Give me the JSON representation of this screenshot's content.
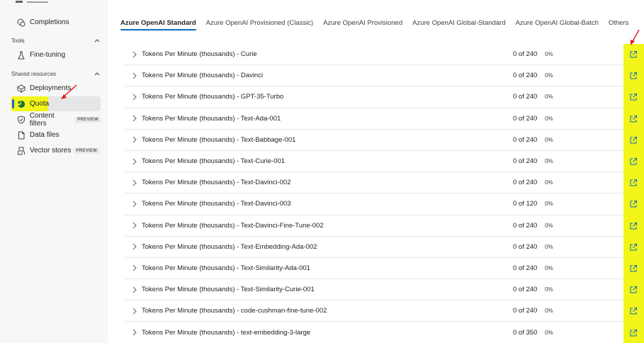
{
  "sidebar": {
    "items": [
      {
        "label": "Completions",
        "icon": "chat-icon"
      },
      {
        "label": "Fine-tuning",
        "icon": "flask-icon"
      },
      {
        "label": "Deployments",
        "icon": "cube-icon"
      },
      {
        "label": "Quota",
        "icon": "pie-chart-icon"
      },
      {
        "label": "Content filters",
        "icon": "shield-icon",
        "badge": "PREVIEW"
      },
      {
        "label": "Data files",
        "icon": "file-icon"
      },
      {
        "label": "Vector stores",
        "icon": "vector-store-icon",
        "badge": "PREVIEW"
      }
    ],
    "sections": {
      "tools": "Tools",
      "shared": "Shared resources"
    }
  },
  "tabs": [
    {
      "label": "Azure OpenAI Standard",
      "active": true
    },
    {
      "label": "Azure OpenAI Provisioned (Classic)"
    },
    {
      "label": "Azure OpenAI Provisioned"
    },
    {
      "label": "Azure OpenAI Global-Standard"
    },
    {
      "label": "Azure OpenAI Global-Batch"
    },
    {
      "label": "Others"
    }
  ],
  "quota_rows": [
    {
      "name": "Tokens Per Minute (thousands) - Curie",
      "usage": "0 of 240",
      "percent": "0%"
    },
    {
      "name": "Tokens Per Minute (thousands) - Davinci",
      "usage": "0 of 240",
      "percent": "0%"
    },
    {
      "name": "Tokens Per Minute (thousands) - GPT-35-Turbo",
      "usage": "0 of 240",
      "percent": "0%"
    },
    {
      "name": "Tokens Per Minute (thousands) - Text-Ada-001",
      "usage": "0 of 240",
      "percent": "0%"
    },
    {
      "name": "Tokens Per Minute (thousands) - Text-Babbage-001",
      "usage": "0 of 240",
      "percent": "0%"
    },
    {
      "name": "Tokens Per Minute (thousands) - Text-Curie-001",
      "usage": "0 of 240",
      "percent": "0%"
    },
    {
      "name": "Tokens Per Minute (thousands) - Text-Davinci-002",
      "usage": "0 of 240",
      "percent": "0%"
    },
    {
      "name": "Tokens Per Minute (thousands) - Text-Davinci-003",
      "usage": "0 of 120",
      "percent": "0%"
    },
    {
      "name": "Tokens Per Minute (thousands) - Text-Davinci-Fine-Tune-002",
      "usage": "0 of 240",
      "percent": "0%"
    },
    {
      "name": "Tokens Per Minute (thousands) - Text-Embedding-Ada-002",
      "usage": "0 of 240",
      "percent": "0%"
    },
    {
      "name": "Tokens Per Minute (thousands) - Text-Similarity-Ada-001",
      "usage": "0 of 240",
      "percent": "0%"
    },
    {
      "name": "Tokens Per Minute (thousands) - Text-Similarity-Curie-001",
      "usage": "0 of 240",
      "percent": "0%"
    },
    {
      "name": "Tokens Per Minute (thousands) - code-cushman-fine-tune-002",
      "usage": "0 of 240",
      "percent": "0%"
    },
    {
      "name": "Tokens Per Minute (thousands) - text-embedding-3-large",
      "usage": "0 of 350",
      "percent": "0%"
    }
  ],
  "colors": {
    "highlight": "#f2f51a",
    "accent": "#0f6cbd",
    "annotation_arrow": "#e02020"
  }
}
